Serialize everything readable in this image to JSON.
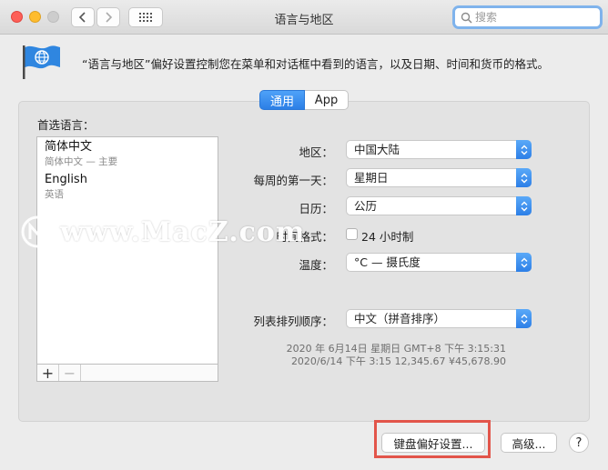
{
  "window": {
    "title": "语言与地区"
  },
  "search": {
    "placeholder": "搜索"
  },
  "header": {
    "description": "“语言与地区”偏好设置控制您在菜单和对话框中看到的语言，以及日期、时间和货币的格式。"
  },
  "tabs": [
    {
      "label": "通用"
    },
    {
      "label": "App"
    }
  ],
  "preferred_languages": {
    "title": "首选语言：",
    "items": [
      {
        "name": "简体中文",
        "sub": "简体中文 — 主要"
      },
      {
        "name": "English",
        "sub": "英语"
      }
    ],
    "add": "+",
    "remove": "−"
  },
  "settings": {
    "region": {
      "label": "地区：",
      "value": "中国大陆"
    },
    "first_day": {
      "label": "每周的第一天：",
      "value": "星期日"
    },
    "calendar": {
      "label": "日历：",
      "value": "公历"
    },
    "time_format": {
      "label": "时间格式：",
      "value": "24 小时制"
    },
    "temperature": {
      "label": "温度：",
      "value": "°C — 摄氏度"
    },
    "sort_order": {
      "label": "列表排列顺序：",
      "value": "中文（拼音排序）"
    }
  },
  "sample": {
    "line1": "2020 年 6月14日 星期日 GMT+8 下午 3:15:31",
    "line2": "2020/6/14 下午 3:15     12,345.67     ¥45,678.90"
  },
  "buttons": {
    "keyboard": "键盘偏好设置...",
    "advanced": "高级...",
    "help": "?"
  },
  "watermark": {
    "text": "www.MacZ.com"
  },
  "colors": {
    "accent": "#2c7fe6",
    "highlight": "#e2554a"
  }
}
